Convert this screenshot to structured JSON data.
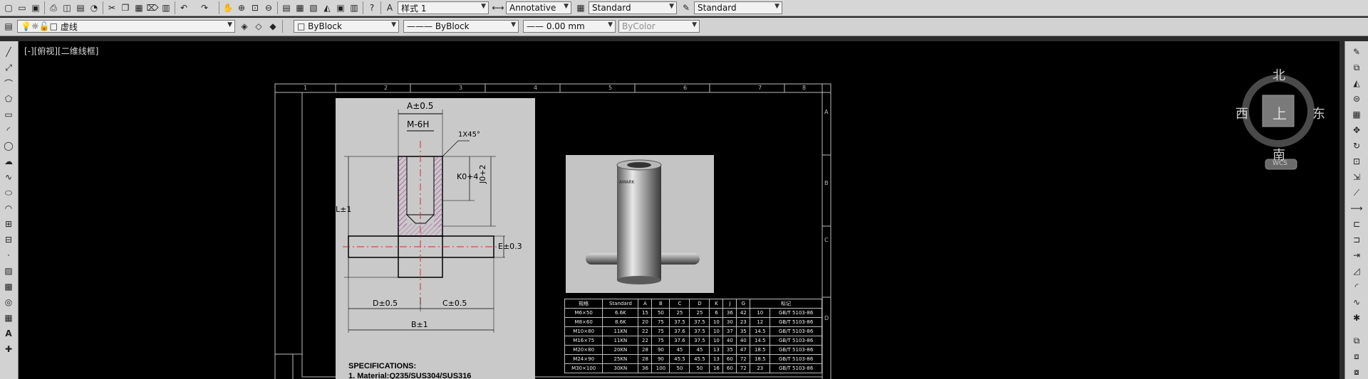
{
  "toolbar1": {
    "text_style": "样式 1",
    "annotative": "Annotative",
    "dim_style": "Standard",
    "table_style": "Standard"
  },
  "toolbar2": {
    "layer": "虚线",
    "color": "ByBlock",
    "linetype": "ByBlock",
    "lineweight": "0.00 mm",
    "plot_style": "ByColor"
  },
  "viewport_label": "[-][俯视][二维线框]",
  "viewcube": {
    "north": "北",
    "south": "南",
    "east": "东",
    "west": "西",
    "face": "上",
    "wcs": "WCS"
  },
  "sheet": {
    "columns": [
      "1",
      "2",
      "3",
      "4",
      "5",
      "6",
      "7",
      "8"
    ],
    "rows": [
      "A",
      "B",
      "C",
      "D"
    ]
  },
  "drawing": {
    "dims": {
      "a": "A±0.5",
      "m": "M-6H",
      "chamfer": "1X45°",
      "k": "K0+4",
      "j": "J0+2",
      "l": "L±1",
      "e": "E±0.3",
      "d": "D±0.5",
      "c": "C±0.5",
      "b": "B±1"
    },
    "specs_title": "SPECIFICATIONS:",
    "specs_line1": "1. Material:Q235/SUS304/SUS316"
  },
  "photo": {
    "label": "AMARK"
  },
  "table": {
    "headers": [
      "规格",
      "Standard",
      "A",
      "B",
      "C",
      "D",
      "K",
      "J",
      "G",
      "标记"
    ],
    "rows": [
      [
        "M6×50",
        "6.6K",
        "15",
        "50",
        "25",
        "25",
        "6",
        "36",
        "42",
        "10",
        "GB/T 5103-86"
      ],
      [
        "M8×60",
        "8.6K",
        "20",
        "75",
        "37.5",
        "37.5",
        "10",
        "30",
        "23",
        "12",
        "GB/T 5103-86"
      ],
      [
        "M10×80",
        "11KN",
        "22",
        "75",
        "37.6",
        "37.5",
        "10",
        "37",
        "35",
        "14.5",
        "GB/T 5103-86"
      ],
      [
        "M16×75",
        "11KN",
        "22",
        "75",
        "37.6",
        "37.5",
        "10",
        "40",
        "40",
        "14.5",
        "GB/T 5103-86"
      ],
      [
        "M20×80",
        "20KN",
        "28",
        "90",
        "45",
        "45",
        "13",
        "35",
        "47",
        "18.5",
        "GB/T 5103-86"
      ],
      [
        "M24×90",
        "25KN",
        "28",
        "90",
        "45.5",
        "45.5",
        "13",
        "60",
        "72",
        "18.5",
        "GB/T 5103-86"
      ],
      [
        "M30×100",
        "30KN",
        "36",
        "100",
        "50",
        "50",
        "16",
        "60",
        "72",
        "23",
        "GB/T 5103-86"
      ]
    ]
  },
  "colors": {
    "background": "#000000",
    "toolbar": "#d6d6d6",
    "hatch": "#cc66aa",
    "centerline": "#cc3333"
  }
}
